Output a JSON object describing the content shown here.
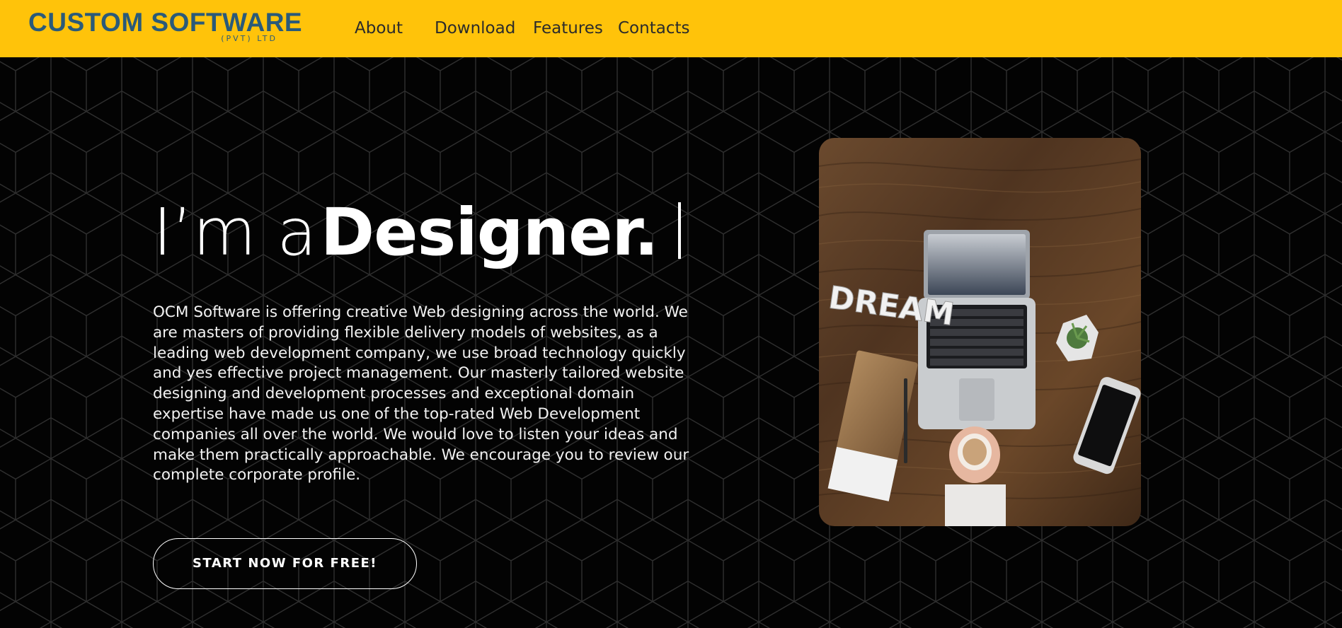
{
  "header": {
    "logo_main": "CUSTOM SOFTWARE",
    "logo_sub": "(PVT) LTD",
    "nav": [
      "About",
      "Download",
      "Features",
      "Contacts"
    ]
  },
  "hero": {
    "headline_prefix": "I’m a",
    "headline_word": "Designer.",
    "description": "OCM Software is offering creative Web designing across the world. We are masters of providing flexible delivery models of websites, as a leading web development company, we use broad technology quickly and yes effective project management. Our masterly tailored website designing and development processes and exceptional domain expertise have made us one of the top-rated Web Development companies all over the world. We would love to listen your ideas and make them practically approachable. We encourage you to review our complete corporate profile.",
    "cta_label": "START NOW FOR FREE!",
    "photo_word": "DREAM"
  },
  "colors": {
    "header_bg": "#ffc30a",
    "logo": "#2a5a79",
    "page_bg": "#030303",
    "pattern_line": "#2e2e2e"
  }
}
